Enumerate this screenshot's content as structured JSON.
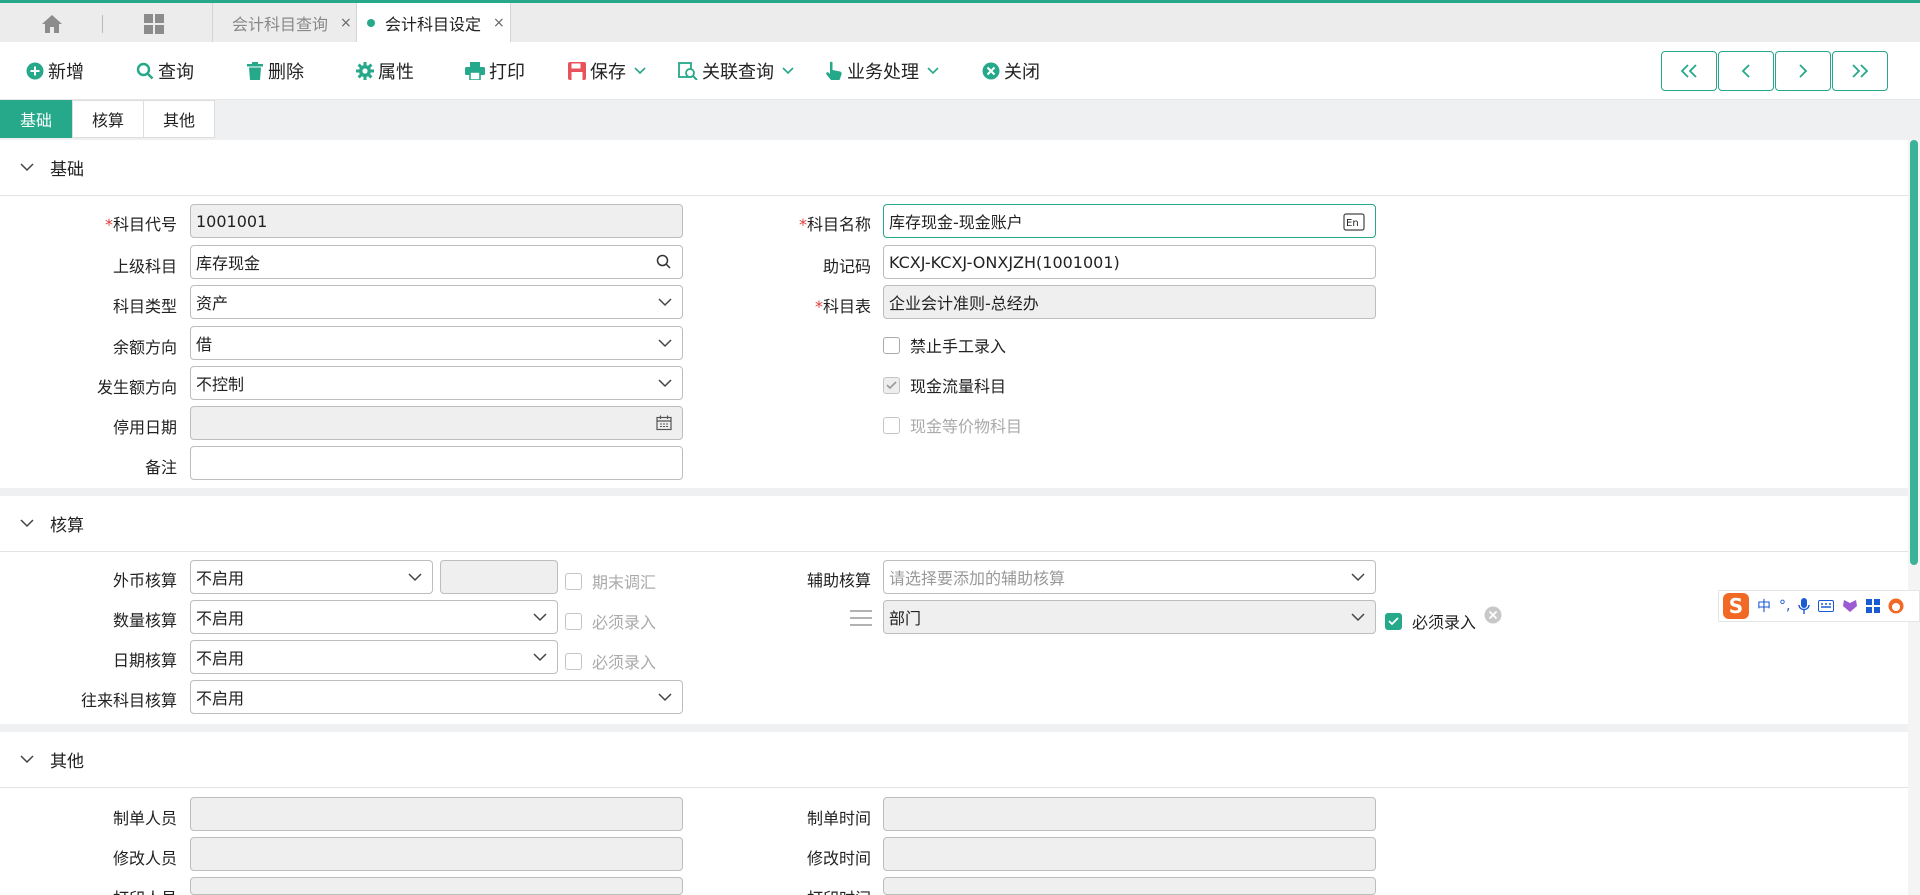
{
  "window_tabs": [
    {
      "label": "会计科目查询",
      "close": "×"
    },
    {
      "label": "会计科目设定",
      "close": "×"
    }
  ],
  "toolbar": {
    "new": "新增",
    "query": "查询",
    "delete": "删除",
    "properties": "属性",
    "print": "打印",
    "save": "保存",
    "related_query": "关联查询",
    "business": "业务处理",
    "close": "关闭"
  },
  "content_tabs": [
    "基础",
    "核算",
    "其他"
  ],
  "basic": {
    "title": "基础",
    "code_label": "科目代号",
    "code_value": "1001001",
    "name_label": "科目名称",
    "name_value": "库存现金-现金账户",
    "parent_label": "上级科目",
    "parent_value": "库存现金",
    "mnemonic_label": "助记码",
    "mnemonic_value": "KCXJ-KCXJ-ONXJZH(1001001)",
    "type_label": "科目类型",
    "type_value": "资产",
    "table_label": "科目表",
    "table_value": "企业会计准则-总经办",
    "balance_label": "余额方向",
    "balance_value": "借",
    "occur_label": "发生额方向",
    "occur_value": "不控制",
    "stop_label": "停用日期",
    "stop_value": "",
    "remark_label": "备注",
    "remark_value": "",
    "chk_manual": "禁止手工录入",
    "chk_cashflow": "现金流量科目",
    "chk_cashequiv": "现金等价物科目"
  },
  "accounting": {
    "title": "核算",
    "fc_label": "外币核算",
    "fc_value": "不启用",
    "fc_chk": "期末调汇",
    "qty_label": "数量核算",
    "qty_value": "不启用",
    "qty_chk": "必须录入",
    "date_label": "日期核算",
    "date_value": "不启用",
    "date_chk": "必须录入",
    "ar_label": "往来科目核算",
    "ar_value": "不启用",
    "aux_label": "辅助核算",
    "aux_placeholder": "请选择要添加的辅助核算",
    "aux_item": "部门",
    "aux_item_chk": "必须录入"
  },
  "other": {
    "title": "其他",
    "creator_label": "制单人员",
    "create_time_label": "制单时间",
    "modifier_label": "修改人员",
    "modify_time_label": "修改时间",
    "printer_label": "打印人员",
    "print_time_label": "打印时间"
  },
  "ime": {
    "zh": "中"
  },
  "colors": {
    "accent": "#26a88a",
    "required": "#e23c3c"
  }
}
